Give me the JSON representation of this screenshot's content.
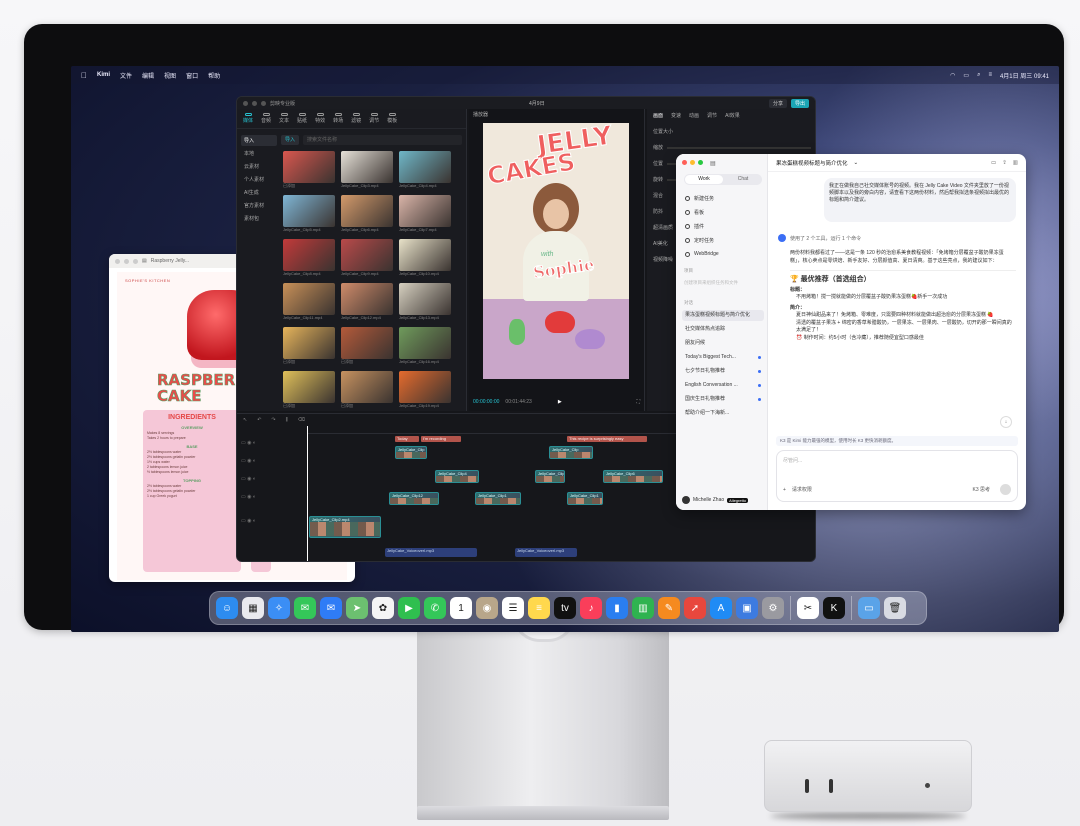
{
  "menubar": {
    "app": "Kimi",
    "menus": [
      "文件",
      "编辑",
      "视图",
      "窗口",
      "帮助"
    ],
    "datetime": "4月1日 周三 09:41"
  },
  "capcut": {
    "title": "剪映专业版",
    "center_title": "4月9日",
    "btn_share": "分享",
    "btn_export": "导出",
    "tools": [
      "媒体",
      "音频",
      "文本",
      "贴纸",
      "特效",
      "转场",
      "滤镜",
      "调节",
      "模板",
      "素材包"
    ],
    "left_nav": [
      "导入",
      "本地",
      "云素材",
      "个人素材",
      "AI生成",
      "官方素材",
      "素材包"
    ],
    "import_label": "导入",
    "search_placeholder": "搜索文件名称",
    "thumb_labels": [
      "已添加",
      "JellyCake_Clip3.mp4",
      "JellyCake_Clip4.mp4",
      "JellyCake_Clip5.mp4",
      "JellyCake_Clip6.mp4",
      "JellyCake_Clip7.mp4",
      "JellyCake_Clip8.mp4",
      "JellyCake_Clip9.mp4",
      "JellyCake_Clip10.mp4",
      "JellyCake_Clip11.mp4",
      "JellyCake_Clip12.mp4",
      "JellyCake_Clip13.mp4",
      "已添加",
      "已添加",
      "JellyCake_Clip16.mp4",
      "已添加",
      "已添加",
      "JellyCake_Clip19.mp4"
    ],
    "player_header": "播放器",
    "video_text": {
      "line1": "JELLY",
      "line2": "CAKES",
      "with": "with",
      "name": "Sophie"
    },
    "time_current": "00:00:00:00",
    "time_total": "00:01:44:23",
    "prop_tabs": [
      "画面",
      "变速",
      "动画",
      "调节",
      "AI效果"
    ],
    "prop_rows": [
      "位置大小",
      "缩放",
      "位置",
      "旋转",
      "混合",
      "防抖",
      "超清画质",
      "AI美化",
      "视频降噪"
    ],
    "text_clips": [
      "Today",
      "I'm recording",
      "This recipe is surprisingly easy",
      "JellyCake_Clip"
    ],
    "clips": [
      "JellyCake_Clip",
      "JellyCake_Clip4",
      "JellyCake_Clip3",
      "JellyCake_Clip6",
      "JellyCake_Clip12",
      "JellyCake_Clip1",
      "JellyCake_Clip2.mp4"
    ],
    "audio_clips": [
      "JellyCake_VoiceoverI.mp3",
      "JellyCake_VoiceoverI.mp3"
    ]
  },
  "recipe": {
    "window_title": "Raspberry Jelly...",
    "caption": "SOPHIE'S KITCHEN",
    "title_line1": "RASPBERRY",
    "title_line2": "CAKE",
    "ingredients_title": "INGREDIENTS",
    "sections": [
      {
        "name": "OVERVIEW",
        "lines": [
          "Makes 8 servings",
          "Takes 2 hours to prepare"
        ]
      },
      {
        "name": "BASE",
        "lines": [
          "2½ tablespoons water",
          "2½ tablespoons gelatin powder",
          "1½ cups water",
          "2 tablespoons lemon juice",
          "½ tablespoons lemon juice"
        ]
      },
      {
        "name": "TOPPING",
        "lines": [
          "2½ tablespoons water",
          "2½ tablespoons gelatin powder",
          "1 cup Greek yogurt"
        ]
      }
    ]
  },
  "kimi": {
    "segment": [
      "Work",
      "Chat"
    ],
    "nav": [
      "新建任务",
      "看板",
      "插件",
      "定时任务",
      "WebBridge"
    ],
    "section_projects": "项目",
    "projects_hint": "创建项目来组织任务和文件",
    "section_history": "对话",
    "history": [
      "果冻蛋糕视频标题与简介优化",
      "社交媒体热点追踪",
      "朋友问候",
      "Today's Biggest Tech...",
      "七夕节日礼物推荐",
      "English Conversation ...",
      "国庆生日礼物推荐",
      "帮助介绍一下海新..."
    ],
    "user_name": "Michelle Zhao",
    "user_tag": "Allegretto",
    "chat_title": "果冻蛋糕视频标题与简介优化",
    "user_message": "我正在做我自己社交媒体账号的视频。我在 Jelly Cake Video 文件夹里放了一份视频脚本以及我的旁白内容，请查看下这两份材料，然后帮我拟选条视频拟出最优的标题和简介建议。",
    "tool_note": "使用了 2 个工具，运行 1 个命令",
    "intro": "两份材料我都看过了——这是一条 120 秒的治愈系美食教程视频：「免烤箱分层覆盆子酸奶果冻蛋糕」，核心卖点是零烘焙、新手友好、分层颜值高、夏日清爽。基于这些亮点，我的建议如下：",
    "best_title": "🏆 最优推荐（首选组合）",
    "label_title": "标题：",
    "title_text": "不用烤箱！搅一搅就能做的分层覆盆子酸奶果冻蛋糕🍓新手一次成功",
    "label_intro": "简介：",
    "intro_text_1": "夏日神仙甜品来了！免烤箱、零难度，只需要四种材料就能做出超治愈的分层果冻蛋糕 🍓",
    "intro_text_2": "清透的覆盆子果冻 + 绵密的香草希腊酸奶，一层果冻、一层果肉、一层酸奶，切开的那一瞬间真的太满足了！",
    "intro_text_3": "⏰ 制作时间：约5小时（含冷藏），推荐随便宜型口感最佳",
    "k2_note": "K3 是 Kimi 能力最强的模型，使用时长 K3 更快消耗额度。",
    "input_placeholder": "尽管问...",
    "input_mode": "请求权限",
    "model": "K3 思考"
  },
  "dock": {
    "apps": [
      "finder-icon",
      "launchpad-icon",
      "safari-icon",
      "messages-icon",
      "mail-icon",
      "maps-icon",
      "photos-icon",
      "facetime-icon",
      "phone-icon",
      "calendar-icon",
      "contacts-icon",
      "reminders-icon",
      "notes-icon",
      "tv-icon",
      "music-icon",
      "keynote-icon",
      "numbers-icon",
      "pages-icon",
      "rocket-icon",
      "appstore-icon",
      "preview-icon",
      "settings-icon",
      "capcut-icon",
      "kimi-icon",
      "folder-icon",
      "trash-icon"
    ],
    "calendar_day": "1",
    "tv_label": "tv"
  }
}
